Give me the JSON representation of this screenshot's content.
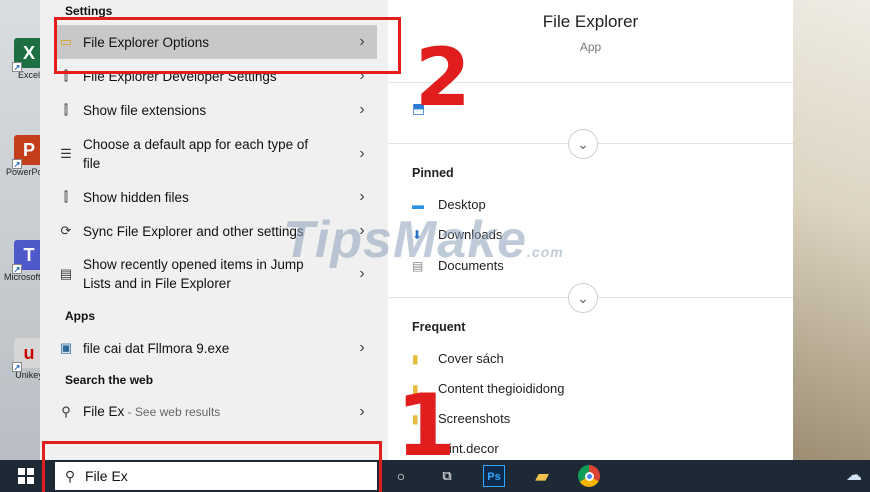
{
  "desktop_icons": [
    {
      "label": "Excel",
      "glyph": "X",
      "color": "#1d6f42"
    },
    {
      "label": "PowerPoint",
      "glyph": "P",
      "color": "#c43e1c"
    },
    {
      "label": "Microsoft Teams",
      "glyph": "T",
      "color": "#5059c9"
    },
    {
      "label": "Unikey",
      "glyph": "u",
      "color": "#d6d6d6"
    }
  ],
  "results": {
    "settings_header": "Settings",
    "settings": [
      {
        "label": "File Explorer Options",
        "icon": "folder-options-icon",
        "selected": true
      },
      {
        "label": "File Explorer Developer Settings",
        "icon": "developer-settings-icon"
      },
      {
        "label": "Show file extensions",
        "icon": "developer-settings-icon"
      },
      {
        "label": "Choose a default app for each type of file",
        "icon": "list-icon"
      },
      {
        "label": "Show hidden files",
        "icon": "developer-settings-icon"
      },
      {
        "label": "Sync File Explorer and other settings",
        "icon": "sync-icon"
      },
      {
        "label": "Show recently opened items in Jump Lists and in File Explorer",
        "icon": "jumplist-icon"
      }
    ],
    "apps_header": "Apps",
    "apps": [
      {
        "label": "file cai dat Fllmora 9.exe",
        "icon": "exe-file-icon"
      }
    ],
    "web_header": "Search the web",
    "web": [
      {
        "label": "File Ex",
        "sub": " - See web results",
        "icon": "search-icon"
      }
    ]
  },
  "preview": {
    "title": "File Explorer",
    "subtitle": "App",
    "pinned_header": "Pinned",
    "pinned": [
      "Desktop",
      "Downloads",
      "Documents"
    ],
    "frequent_header": "Frequent",
    "frequent": [
      "Cover sách",
      "Content thegioididong",
      "Screenshots",
      "Mint.decor"
    ]
  },
  "watermark": {
    "text": "TipsMake",
    "suffix": ".com"
  },
  "annotations": {
    "step1": "1",
    "step2": "2",
    "color": "#e11d1d"
  },
  "taskbar": {
    "search_value": "File Ex",
    "icons": [
      "cortana-icon",
      "task-view-icon",
      "photoshop-icon",
      "file-explorer-icon",
      "chrome-icon",
      "onedrive-icon"
    ],
    "ps_label": "Ps"
  }
}
